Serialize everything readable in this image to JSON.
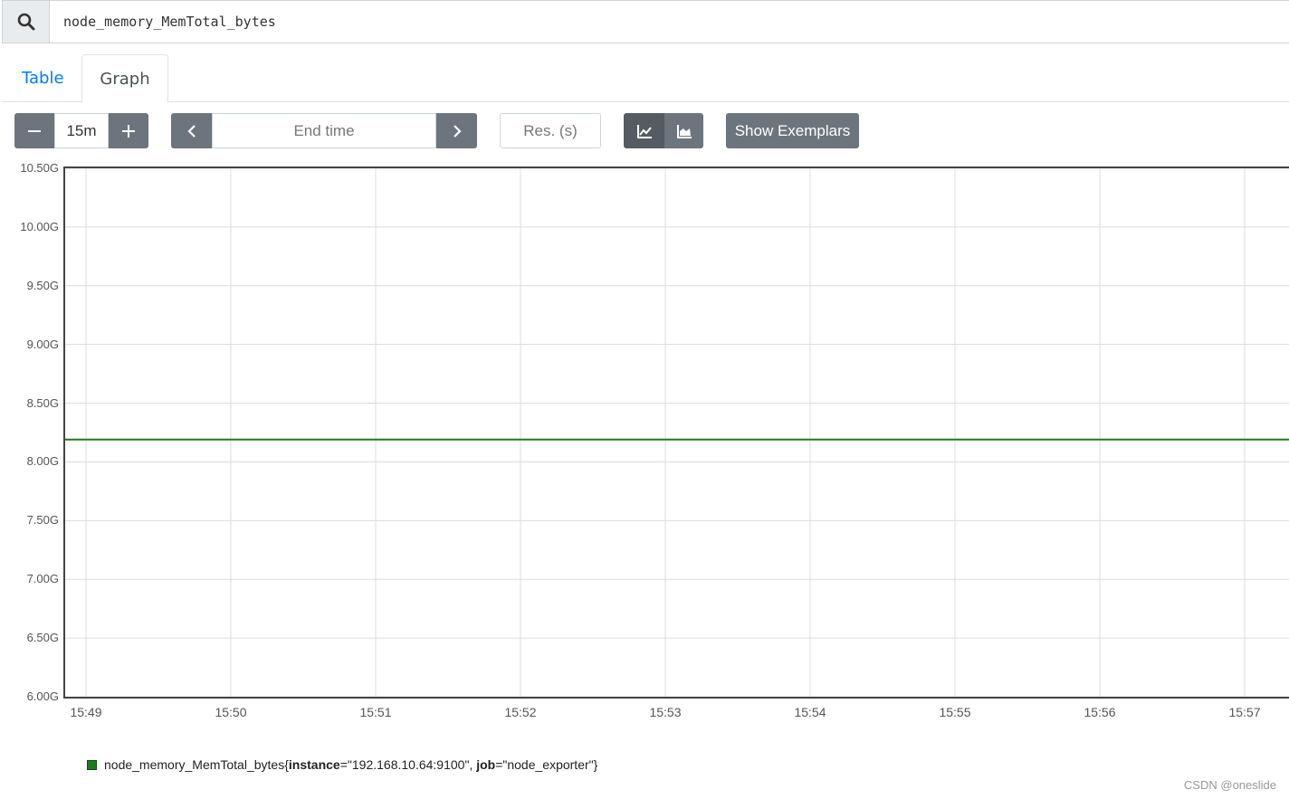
{
  "query": {
    "value": "node_memory_MemTotal_bytes"
  },
  "tabs": [
    {
      "label": "Table"
    },
    {
      "label": "Graph"
    }
  ],
  "controls": {
    "range": "15m",
    "end_time_placeholder": "End time",
    "resolution_placeholder": "Res. (s)",
    "show_exemplars": "Show Exemplars"
  },
  "chart_data": {
    "type": "line",
    "ylim": [
      6.0,
      10.5
    ],
    "y_ticks": [
      "10.50G",
      "10.00G",
      "9.50G",
      "9.00G",
      "8.50G",
      "8.00G",
      "7.50G",
      "7.00G",
      "6.50G",
      "6.00G"
    ],
    "x_ticks": [
      "15:49",
      "15:50",
      "15:51",
      "15:52",
      "15:53",
      "15:54",
      "15:55",
      "15:56",
      "15:57"
    ],
    "series": [
      {
        "name": "node_memory_MemTotal_bytes{instance=\"192.168.10.64:9100\", job=\"node_exporter\"}",
        "color": "#1e7a1e",
        "x": [
          "15:48:50",
          "15:57:20"
        ],
        "values": [
          8.19,
          8.19
        ]
      }
    ],
    "grid": true
  },
  "legend": {
    "metric": "node_memory_MemTotal_bytes",
    "open": "{",
    "label1_key": "instance",
    "label1_eq": "=",
    "label1_val": "\"192.168.10.64:9100\"",
    "sep": ", ",
    "label2_key": "job",
    "label2_eq": "=",
    "label2_val": "\"node_exporter\"",
    "close": "}"
  },
  "watermark": "CSDN @oneslide"
}
